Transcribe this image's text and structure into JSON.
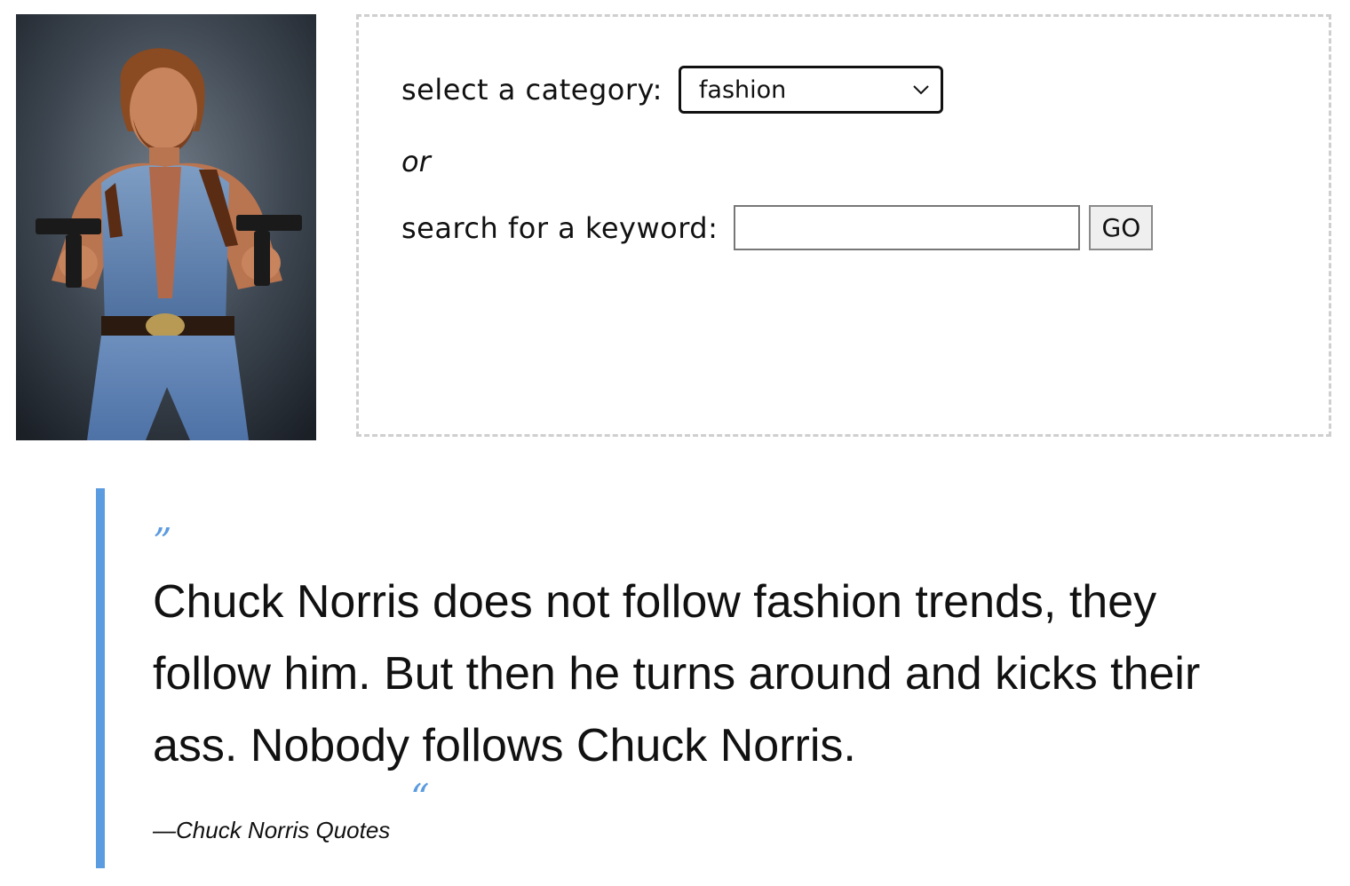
{
  "photo": {
    "alt": "Chuck Norris holding two pistols"
  },
  "search": {
    "category_label": "select a category:",
    "category_value": "fashion",
    "or_label": "or",
    "keyword_label": "search for a keyword:",
    "keyword_value": "",
    "go_label": "GO"
  },
  "quote": {
    "open_mark": "”",
    "text": "Chuck Norris does not follow fashion trends, they follow him. But then he turns around and kicks their ass. Nobody follows Chuck Norris.",
    "source": "—Chuck Norris Quotes",
    "close_mark": "“"
  },
  "colors": {
    "accent": "#5b9be0",
    "panel_border": "#cfcfcf"
  }
}
